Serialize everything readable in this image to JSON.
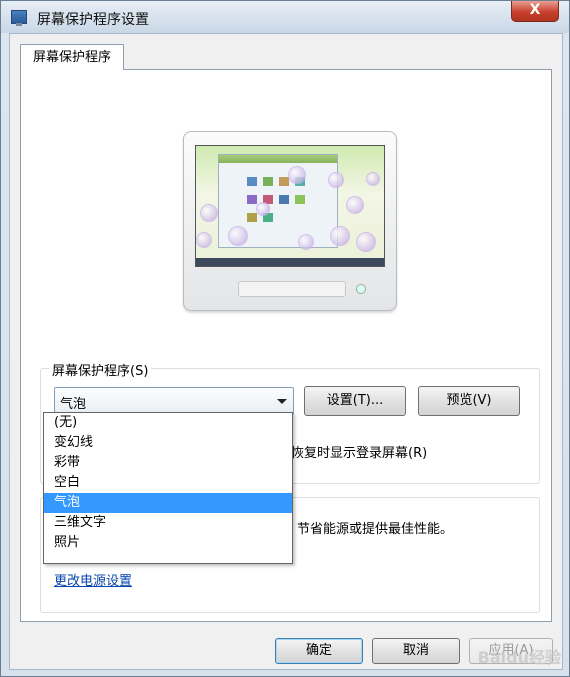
{
  "window": {
    "title": "屏幕保护程序设置",
    "close_symbol": "X"
  },
  "tab": {
    "label": "屏幕保护程序"
  },
  "screensaver": {
    "group_title": "屏幕保护程序(S)",
    "selected": "气泡",
    "settings_button": "设置(T)...",
    "preview_button": "预览(V)",
    "resume_checkbox_label_partial": "恢复时显示登录屏幕(R)",
    "options": [
      "(无)",
      "变幻线",
      "彩带",
      "空白",
      "气泡",
      "三维文字",
      "照片"
    ],
    "selected_index": 4
  },
  "power": {
    "description_partial": "节省能源或提供最佳性能。",
    "link": "更改电源设置"
  },
  "footer": {
    "ok_button": "确定",
    "cancel_button": "取消",
    "apply_button": "应用(A)"
  },
  "watermark": "Baidu经验",
  "colors": {
    "selection": "#3399ff",
    "link": "#0645ad",
    "close_button": "#c7402d"
  }
}
